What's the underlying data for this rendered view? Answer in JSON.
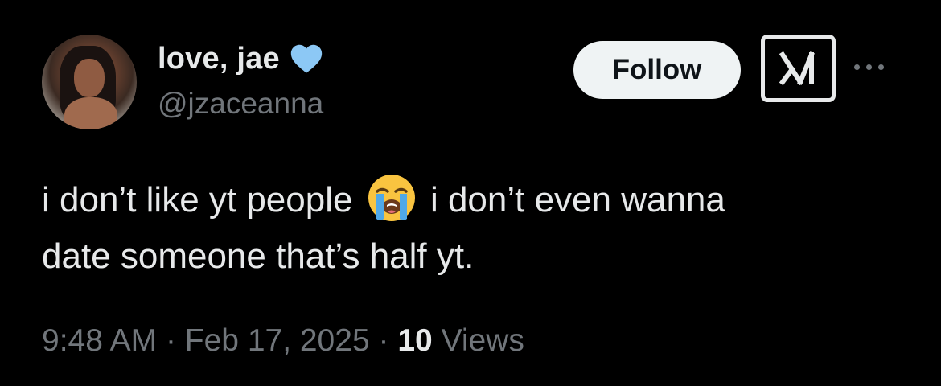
{
  "author": {
    "display_name": "love, jae",
    "handle": "@jzaceanna",
    "verified_icon": "verified-heart-icon",
    "verified_color": "#8cc8f5"
  },
  "actions": {
    "follow_label": "Follow",
    "grok_icon": "grok-icon",
    "more_icon": "more-dots-icon"
  },
  "tweet": {
    "text_part1": "i don’t like yt people",
    "emoji": "loudly-crying-face-emoji",
    "text_part2": "i don’t even wanna",
    "text_line2": "date someone that’s half yt."
  },
  "meta": {
    "time": "9:48 AM",
    "separator": "·",
    "date": "Feb 17, 2025",
    "views_count": "10",
    "views_label": "Views"
  }
}
